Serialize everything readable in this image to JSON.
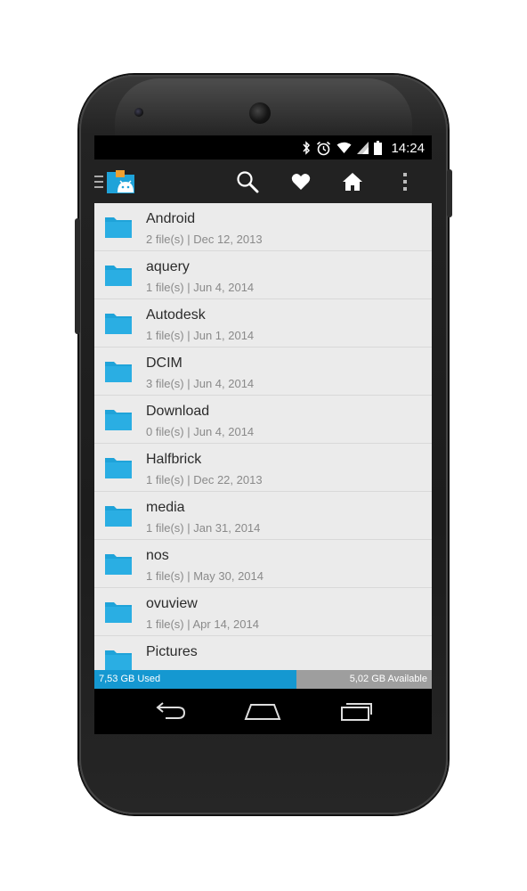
{
  "status_bar": {
    "time": "14:24",
    "icons": [
      "bluetooth-icon",
      "alarm-icon",
      "wifi-icon",
      "signal-icon",
      "battery-icon"
    ]
  },
  "action_bar": {
    "icons": [
      "drawer-menu-icon",
      "app-logo-icon",
      "search-icon",
      "heart-icon",
      "home-icon",
      "overflow-menu-icon"
    ]
  },
  "files": [
    {
      "name": "Android",
      "meta": "2 file(s) | Dec 12, 2013"
    },
    {
      "name": "aquery",
      "meta": "1 file(s) | Jun 4, 2014"
    },
    {
      "name": "Autodesk",
      "meta": "1 file(s) | Jun 1, 2014"
    },
    {
      "name": "DCIM",
      "meta": "3 file(s) | Jun 4, 2014"
    },
    {
      "name": "Download",
      "meta": "0 file(s) | Jun 4, 2014"
    },
    {
      "name": "Halfbrick",
      "meta": "1 file(s) | Dec 22, 2013"
    },
    {
      "name": "media",
      "meta": "1 file(s) | Jan 31, 2014"
    },
    {
      "name": "nos",
      "meta": "1 file(s) | May 30, 2014"
    },
    {
      "name": "ovuview",
      "meta": "1 file(s) | Apr 14, 2014"
    },
    {
      "name": "Pictures",
      "meta": ""
    }
  ],
  "storage": {
    "used_label": "7,53 GB Used",
    "available_label": "5,02 GB Available",
    "used_fraction": 0.6,
    "used_color": "#1598d1"
  },
  "nav_bar": {
    "icons": [
      "back-icon",
      "home-nav-icon",
      "recents-icon"
    ]
  },
  "colors": {
    "folder": "#1fa3d9",
    "action_bar": "#222222",
    "list_background": "#ebebeb"
  }
}
